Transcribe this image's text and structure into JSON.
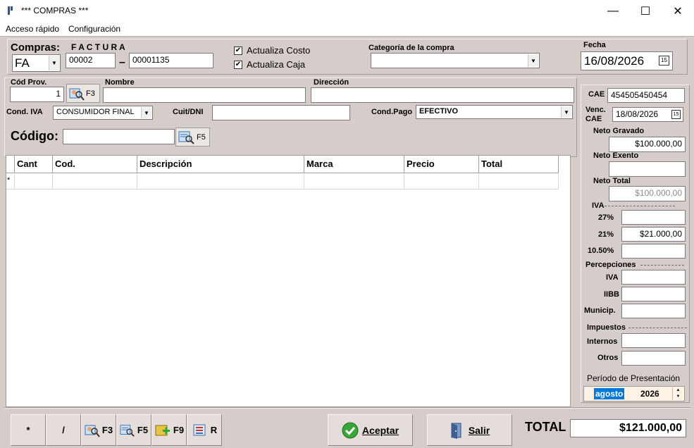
{
  "window": {
    "title": "*** COMPRAS ***",
    "minimize": "—",
    "maximize": "☐",
    "close": "✕"
  },
  "menu": {
    "items": [
      "Acceso rápido",
      "Configuración"
    ]
  },
  "header": {
    "compras_label": "Compras:",
    "factura_label": "F A C T U R A",
    "tipo_value": "FA",
    "punto_venta": "00002",
    "dash": "–",
    "numero": "00001135",
    "actualiza_costo_label": "Actualiza Costo",
    "actualiza_caja_label": "Actualiza Caja",
    "check_mark": "✔",
    "categoria_label": "Categoría de la compra",
    "categoria_value": "",
    "fecha_label": "Fecha",
    "fecha_value": "16/08/2026",
    "cal_glyph": "15"
  },
  "provider": {
    "cod_label": "Cód Prov.",
    "cod_value": "1",
    "f3_label": "F3",
    "nombre_label": "Nombre",
    "nombre_value": "",
    "direccion_label": "Dirección",
    "direccion_value": "",
    "cond_iva_label": "Cond. IVA",
    "cond_iva_value": "CONSUMIDOR FINAL",
    "cuit_label": "Cuit/DNI",
    "cuit_value": "",
    "cond_pago_label": "Cond.Pago",
    "cond_pago_value": "EFECTIVO"
  },
  "codigo": {
    "label": "Código:",
    "value": "",
    "f5_label": "F5"
  },
  "grid": {
    "columns": [
      "Cant",
      "Cod.",
      "Descripción",
      "Marca",
      "Precio",
      "Total"
    ],
    "new_row_marker": "*"
  },
  "side": {
    "cae_label": "CAE",
    "cae_value": "454505450454",
    "venc_label": "Venc.",
    "venc_label2": "CAE",
    "venc_value": "18/08/2026",
    "neto_gravado_label": "Neto Gravado",
    "neto_gravado_value": "$100.000,00",
    "neto_exento_label": "Neto Exento",
    "neto_exento_value": "",
    "neto_total_label": "Neto Total",
    "neto_total_value": "$100.000,00",
    "iva_label": "IVA",
    "iva_27_label": "27%",
    "iva_27_value": "",
    "iva_21_label": "21%",
    "iva_21_value": "$21.000,00",
    "iva_1050_label": "10.50%",
    "iva_1050_value": "",
    "percepciones_label": "Percepciones",
    "perc_iva_label": "IVA",
    "perc_iva_value": "",
    "perc_iibb_label": "IIBB",
    "perc_iibb_value": "",
    "perc_municip_label": "Municip.",
    "perc_municip_value": "",
    "impuestos_label": "Impuestos",
    "internos_label": "Internos",
    "internos_value": "",
    "otros_label": "Otros",
    "otros_value": "",
    "periodo_label": "Período de Presentación",
    "periodo_mes": "agosto",
    "periodo_anio": "2026"
  },
  "footer": {
    "btn_star": "*",
    "btn_slash": "/",
    "btn_f3": "F3",
    "btn_f5": "F5",
    "btn_f9": "F9",
    "btn_r": "R",
    "aceptar_label": "Aceptar",
    "salir_label": "Salir",
    "total_label": "TOTAL",
    "total_value": "$121.000,00"
  },
  "colors": {
    "form_bg": "#d6cdcb",
    "highlight": "#0078d7",
    "accept_green": "#3aa63a"
  }
}
